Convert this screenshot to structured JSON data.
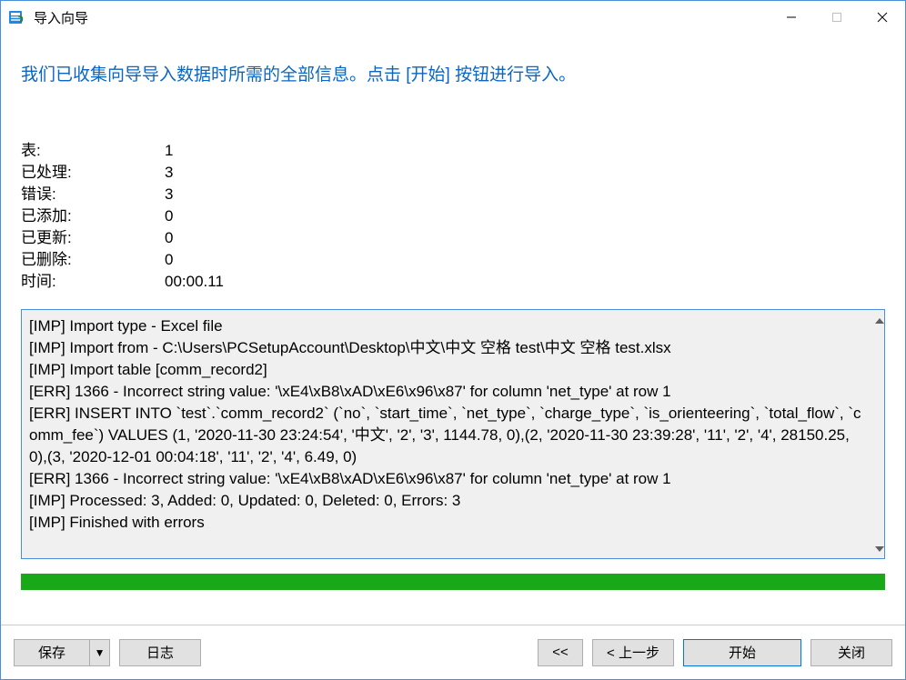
{
  "window": {
    "title": "导入向导"
  },
  "headline": "我们已收集向导导入数据时所需的全部信息。点击 [开始] 按钮进行导入。",
  "stats": {
    "rows": [
      {
        "label": "表:",
        "value": "1"
      },
      {
        "label": "已处理:",
        "value": "3"
      },
      {
        "label": "错误:",
        "value": "3"
      },
      {
        "label": "已添加:",
        "value": "0"
      },
      {
        "label": "已更新:",
        "value": "0"
      },
      {
        "label": "已删除:",
        "value": "0"
      },
      {
        "label": "时间:",
        "value": "00:00.11"
      }
    ]
  },
  "log_lines": [
    "[IMP] Import type - Excel file",
    "[IMP] Import from - C:\\Users\\PCSetupAccount\\Desktop\\中文\\中文 空格 test\\中文 空格 test.xlsx",
    "[IMP] Import table [comm_record2]",
    "[ERR] 1366 - Incorrect string value: '\\xE4\\xB8\\xAD\\xE6\\x96\\x87' for column 'net_type' at row 1",
    "[ERR] INSERT INTO `test`.`comm_record2` (`no`, `start_time`, `net_type`, `charge_type`, `is_orienteering`, `total_flow`, `comm_fee`) VALUES (1, '2020-11-30 23:24:54', '中文', '2', '3', 1144.78, 0),(2, '2020-11-30 23:39:28', '11', '2', '4', 28150.25, 0),(3, '2020-12-01 00:04:18', '11', '2', '4', 6.49, 0)",
    "[ERR] 1366 - Incorrect string value: '\\xE4\\xB8\\xAD\\xE6\\x96\\x87' for column 'net_type' at row 1",
    "[IMP] Processed: 3, Added: 0, Updated: 0, Deleted: 0, Errors: 3",
    "[IMP] Finished with errors"
  ],
  "progress": {
    "percent": 100
  },
  "footer": {
    "save": "保存",
    "log": "日志",
    "back_small": "<<",
    "prev": "< 上一步",
    "start": "开始",
    "close": "关闭"
  }
}
